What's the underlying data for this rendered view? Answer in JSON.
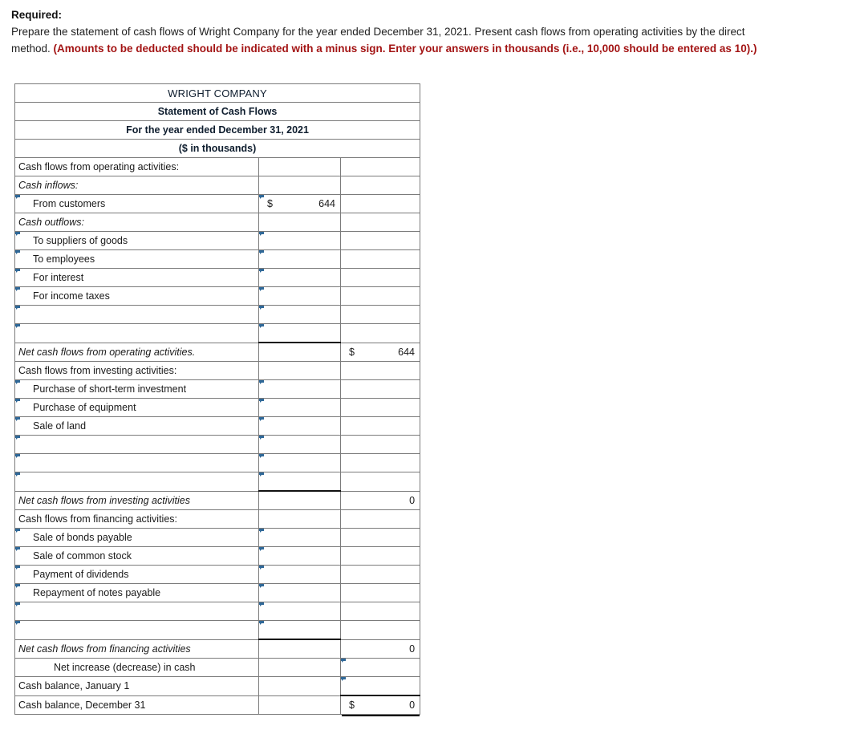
{
  "instructions": {
    "required_label": "Required:",
    "body_part1": "Prepare the statement of cash flows of Wright Company for the year ended December 31, 2021. Present cash flows from operating activities by the direct method. ",
    "body_emphasis": "(Amounts to be deducted should be indicated with a minus sign. Enter your answers in thousands (i.e., 10,000 should be entered as 10).)",
    "emphasis_color": "#a31414"
  },
  "statement": {
    "header": {
      "company": "WRIGHT COMPANY",
      "title": "Statement of Cash Flows",
      "period": "For the year ended December 31, 2021",
      "units": "($ in thousands)",
      "header_bg": "#76a9de"
    },
    "rows": [
      {
        "label": "Cash flows from operating activities:",
        "indent": 0,
        "italic": false,
        "label_editable": false,
        "mid": {
          "type": "plain",
          "currency": "",
          "value": ""
        },
        "right": {
          "type": "plain",
          "currency": "",
          "value": ""
        }
      },
      {
        "label": "Cash inflows:",
        "indent": 0,
        "italic": true,
        "label_editable": false,
        "mid": {
          "type": "plain",
          "currency": "",
          "value": ""
        },
        "right": {
          "type": "plain",
          "currency": "",
          "value": ""
        }
      },
      {
        "label": "From customers",
        "indent": 1,
        "italic": false,
        "label_editable": true,
        "mid": {
          "type": "edit",
          "currency": "$",
          "value": "644"
        },
        "right": {
          "type": "plain",
          "currency": "",
          "value": ""
        }
      },
      {
        "label": "Cash outflows:",
        "indent": 0,
        "italic": true,
        "label_editable": false,
        "mid": {
          "type": "plain",
          "currency": "",
          "value": ""
        },
        "right": {
          "type": "plain",
          "currency": "",
          "value": ""
        }
      },
      {
        "label": "To suppliers of goods",
        "indent": 1,
        "italic": false,
        "label_editable": true,
        "mid": {
          "type": "edit",
          "currency": "",
          "value": ""
        },
        "right": {
          "type": "plain",
          "currency": "",
          "value": ""
        }
      },
      {
        "label": "To employees",
        "indent": 1,
        "italic": false,
        "label_editable": true,
        "mid": {
          "type": "edit",
          "currency": "",
          "value": ""
        },
        "right": {
          "type": "plain",
          "currency": "",
          "value": ""
        }
      },
      {
        "label": "For interest",
        "indent": 1,
        "italic": false,
        "label_editable": true,
        "mid": {
          "type": "edit",
          "currency": "",
          "value": ""
        },
        "right": {
          "type": "plain",
          "currency": "",
          "value": ""
        }
      },
      {
        "label": "For income taxes",
        "indent": 1,
        "italic": false,
        "label_editable": true,
        "mid": {
          "type": "edit",
          "currency": "",
          "value": ""
        },
        "right": {
          "type": "plain",
          "currency": "",
          "value": ""
        }
      },
      {
        "label": "",
        "indent": 1,
        "italic": false,
        "label_editable": true,
        "mid": {
          "type": "edit",
          "currency": "",
          "value": ""
        },
        "right": {
          "type": "plain",
          "currency": "",
          "value": ""
        }
      },
      {
        "label": "",
        "indent": 1,
        "italic": false,
        "label_editable": true,
        "mid": {
          "type": "edit",
          "currency": "",
          "value": "",
          "rule": true
        },
        "right": {
          "type": "plain",
          "currency": "",
          "value": ""
        }
      },
      {
        "label": "Net cash flows from operating activities.",
        "indent": 0,
        "italic": true,
        "label_editable": false,
        "mid": {
          "type": "plain",
          "currency": "",
          "value": ""
        },
        "right": {
          "type": "plain",
          "currency": "$",
          "value": "644"
        }
      },
      {
        "label": "Cash flows from investing activities:",
        "indent": 0,
        "italic": false,
        "label_editable": false,
        "mid": {
          "type": "plain",
          "currency": "",
          "value": ""
        },
        "right": {
          "type": "plain",
          "currency": "",
          "value": ""
        }
      },
      {
        "label": "Purchase of short-term investment",
        "indent": 1,
        "italic": false,
        "label_editable": true,
        "mid": {
          "type": "edit",
          "currency": "",
          "value": ""
        },
        "right": {
          "type": "plain",
          "currency": "",
          "value": ""
        }
      },
      {
        "label": "Purchase of equipment",
        "indent": 1,
        "italic": false,
        "label_editable": true,
        "mid": {
          "type": "edit",
          "currency": "",
          "value": ""
        },
        "right": {
          "type": "plain",
          "currency": "",
          "value": ""
        }
      },
      {
        "label": "Sale of land",
        "indent": 1,
        "italic": false,
        "label_editable": true,
        "mid": {
          "type": "edit",
          "currency": "",
          "value": ""
        },
        "right": {
          "type": "plain",
          "currency": "",
          "value": ""
        }
      },
      {
        "label": "",
        "indent": 1,
        "italic": false,
        "label_editable": true,
        "mid": {
          "type": "edit",
          "currency": "",
          "value": ""
        },
        "right": {
          "type": "plain",
          "currency": "",
          "value": ""
        }
      },
      {
        "label": "",
        "indent": 1,
        "italic": false,
        "label_editable": true,
        "mid": {
          "type": "edit",
          "currency": "",
          "value": ""
        },
        "right": {
          "type": "plain",
          "currency": "",
          "value": ""
        }
      },
      {
        "label": "",
        "indent": 1,
        "italic": false,
        "label_editable": true,
        "mid": {
          "type": "edit",
          "currency": "",
          "value": "",
          "rule": true
        },
        "right": {
          "type": "plain",
          "currency": "",
          "value": ""
        }
      },
      {
        "label": "Net cash flows from investing activities",
        "indent": 0,
        "italic": true,
        "label_editable": false,
        "mid": {
          "type": "plain",
          "currency": "",
          "value": ""
        },
        "right": {
          "type": "plain",
          "currency": "",
          "value": "0"
        }
      },
      {
        "label": "Cash flows from financing activities:",
        "indent": 0,
        "italic": false,
        "label_editable": false,
        "mid": {
          "type": "plain",
          "currency": "",
          "value": ""
        },
        "right": {
          "type": "plain",
          "currency": "",
          "value": ""
        }
      },
      {
        "label": "Sale of bonds payable",
        "indent": 1,
        "italic": false,
        "label_editable": true,
        "mid": {
          "type": "edit",
          "currency": "",
          "value": ""
        },
        "right": {
          "type": "plain",
          "currency": "",
          "value": ""
        }
      },
      {
        "label": "Sale of common stock",
        "indent": 1,
        "italic": false,
        "label_editable": true,
        "mid": {
          "type": "edit",
          "currency": "",
          "value": ""
        },
        "right": {
          "type": "plain",
          "currency": "",
          "value": ""
        }
      },
      {
        "label": "Payment of dividends",
        "indent": 1,
        "italic": false,
        "label_editable": true,
        "mid": {
          "type": "edit",
          "currency": "",
          "value": ""
        },
        "right": {
          "type": "plain",
          "currency": "",
          "value": ""
        }
      },
      {
        "label": "Repayment of notes payable",
        "indent": 1,
        "italic": false,
        "label_editable": true,
        "mid": {
          "type": "edit",
          "currency": "",
          "value": ""
        },
        "right": {
          "type": "plain",
          "currency": "",
          "value": ""
        }
      },
      {
        "label": "",
        "indent": 1,
        "italic": false,
        "label_editable": true,
        "mid": {
          "type": "edit",
          "currency": "",
          "value": ""
        },
        "right": {
          "type": "plain",
          "currency": "",
          "value": ""
        }
      },
      {
        "label": "",
        "indent": 1,
        "italic": false,
        "label_editable": true,
        "mid": {
          "type": "edit",
          "currency": "",
          "value": "",
          "rule": true
        },
        "right": {
          "type": "plain",
          "currency": "",
          "value": ""
        }
      },
      {
        "label": "Net cash flows from financing activities",
        "indent": 0,
        "italic": true,
        "label_editable": false,
        "mid": {
          "type": "plain",
          "currency": "",
          "value": ""
        },
        "right": {
          "type": "plain",
          "currency": "",
          "value": "0"
        }
      },
      {
        "label": "Net increase (decrease) in cash",
        "indent": 2,
        "italic": false,
        "label_editable": false,
        "mid": {
          "type": "plain",
          "currency": "",
          "value": ""
        },
        "right": {
          "type": "edit",
          "currency": "",
          "value": ""
        }
      },
      {
        "label": "Cash balance, January 1",
        "indent": 0,
        "italic": false,
        "label_editable": false,
        "mid": {
          "type": "plain",
          "currency": "",
          "value": ""
        },
        "right": {
          "type": "edit",
          "currency": "",
          "value": "",
          "rule": true
        }
      },
      {
        "label": "Cash balance, December 31",
        "indent": 0,
        "italic": false,
        "label_editable": false,
        "mid": {
          "type": "plain",
          "currency": "",
          "value": ""
        },
        "right": {
          "type": "plain",
          "currency": "$",
          "value": "0",
          "double": true
        }
      }
    ]
  }
}
